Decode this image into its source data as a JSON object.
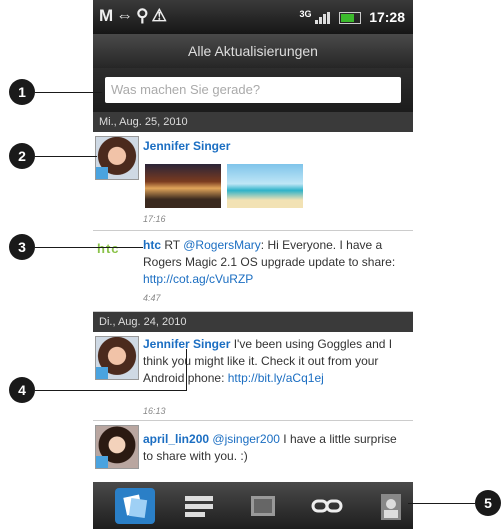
{
  "status_bar": {
    "left_icons": "M⇔⚲⚠",
    "network": "3G",
    "time": "17:28"
  },
  "title": "Alle Aktualisierungen",
  "search": {
    "placeholder": "Was machen Sie gerade?"
  },
  "groups": [
    {
      "date": "Mi., Aug. 25, 2010"
    },
    {
      "date": "Di., Aug. 24, 2010"
    }
  ],
  "posts": [
    {
      "name": "Jennifer Singer",
      "time": "17:16"
    },
    {
      "name": "htc",
      "text": "RT ",
      "mention": "@RogersMary",
      "text2": ": Hi Everyone. I have a Rogers Magic 2.1 OS upgrade update to share: ",
      "url": "http://cot.ag/cVuRZP",
      "time": "4:47"
    },
    {
      "name": "Jennifer Singer",
      "text": " I've been using Goggles and I think you might like it. Check it out from your Android phone: ",
      "url": "http://bit.ly/aCq1ej",
      "time": "16:13"
    },
    {
      "name": "april_lin200",
      "mention": "@jsinger200",
      "text": " I have a little surprise to share with you. :)"
    }
  ],
  "tabs": [
    "all-updates-icon",
    "timeline-icon",
    "photos-icon",
    "links-icon",
    "people-icon"
  ],
  "callouts": [
    "1",
    "2",
    "3",
    "4",
    "5"
  ],
  "colors": {
    "accent": "#1b6ec2",
    "bg": "#1a1a1a"
  }
}
